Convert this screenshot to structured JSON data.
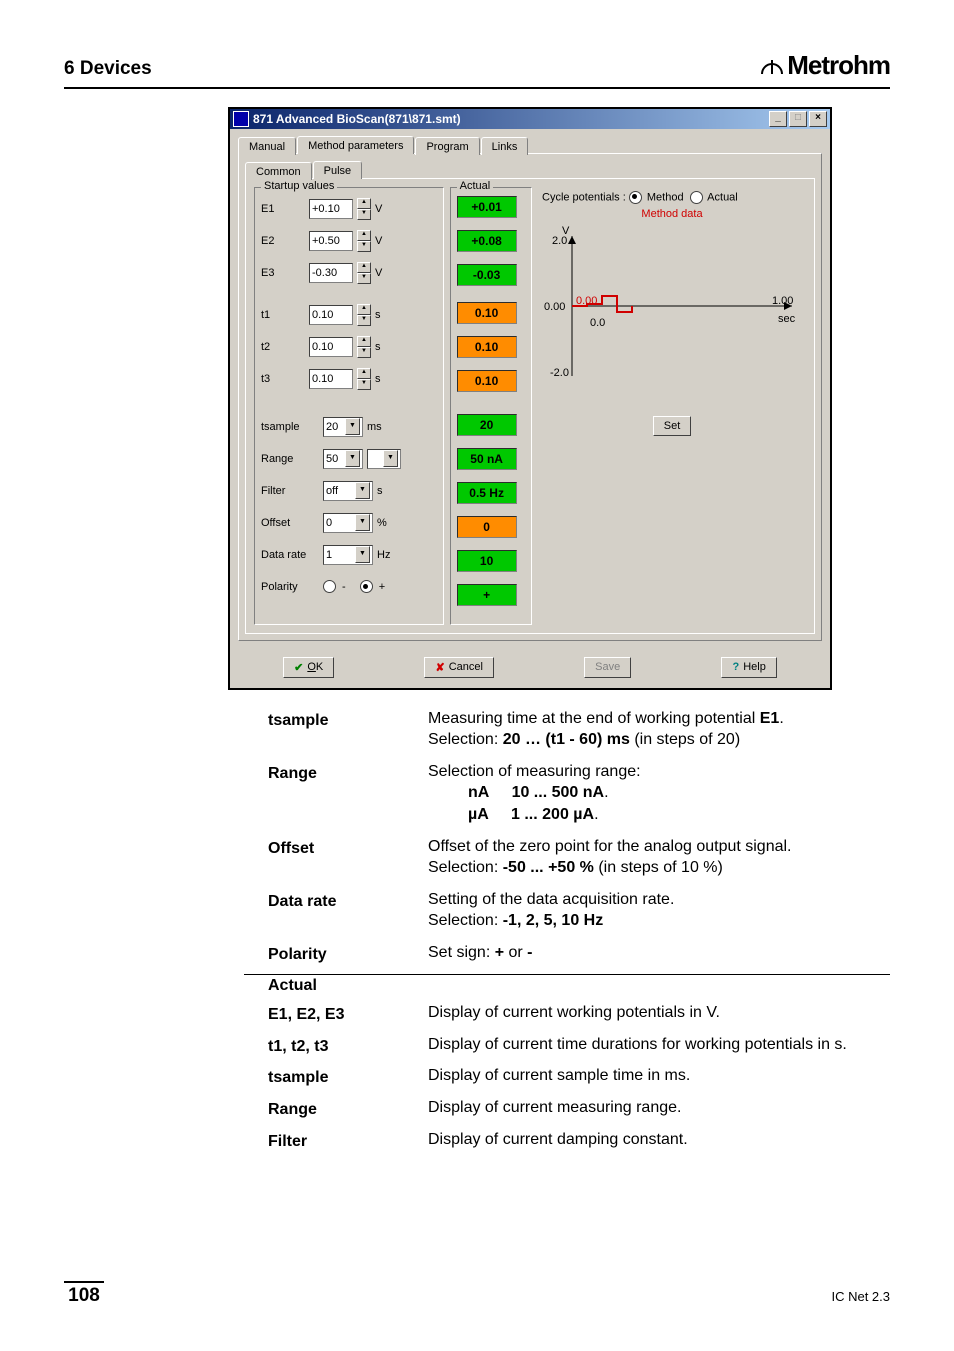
{
  "header": {
    "section": "6 Devices",
    "brand": "Metrohm"
  },
  "window": {
    "title": "871 Advanced BioScan(871\\871.smt)",
    "tabs": {
      "manual": "Manual",
      "method": "Method parameters",
      "program": "Program",
      "links": "Links"
    },
    "subtabs": {
      "common": "Common",
      "pulse": "Pulse"
    }
  },
  "startup": {
    "legend": "Startup values",
    "E1": {
      "label": "E1",
      "value": "+0.10",
      "unit": "V"
    },
    "E2": {
      "label": "E2",
      "value": "+0.50",
      "unit": "V"
    },
    "E3": {
      "label": "E3",
      "value": "-0.30",
      "unit": "V"
    },
    "t1": {
      "label": "t1",
      "value": "0.10",
      "unit": "s"
    },
    "t2": {
      "label": "t2",
      "value": "0.10",
      "unit": "s"
    },
    "t3": {
      "label": "t3",
      "value": "0.10",
      "unit": "s"
    },
    "tsample": {
      "label": "tsample",
      "value": "20",
      "unit": "ms"
    },
    "range": {
      "label": "Range",
      "value": "50",
      "unit2": ""
    },
    "filter": {
      "label": "Filter",
      "value": "off",
      "unit": "s"
    },
    "offset": {
      "label": "Offset",
      "value": "0",
      "unit": "%"
    },
    "datarate": {
      "label": "Data rate",
      "value": "1",
      "unit": "Hz"
    },
    "polarity": {
      "label": "Polarity",
      "minus": "-",
      "plus": "+"
    }
  },
  "actual": {
    "legend": "Actual",
    "E1": "+0.01",
    "E2": "+0.08",
    "E3": "-0.03",
    "t1": "0.10",
    "t2": "0.10",
    "t3": "0.10",
    "tsample": "20",
    "range": "50 nA",
    "filter": "0.5 Hz",
    "offset": "0",
    "datarate": "10",
    "polarity": "+"
  },
  "chart": {
    "cycle_label": "Cycle potentials :",
    "opt_method": "Method",
    "opt_actual": "Actual",
    "caption": "Method data",
    "ylabel": "V",
    "ytop": "2.0",
    "ymid": "0.00",
    "ybot": "-2.0",
    "x0": "0.00",
    "x1": "1.00",
    "xunit": "sec",
    "trace_anchor": "0.0",
    "set_button": "Set"
  },
  "buttons": {
    "ok": "OK",
    "cancel": "Cancel",
    "save": "Save",
    "help": "Help"
  },
  "doc": {
    "tsample": {
      "term": "tsample",
      "line1": "Measuring time at the end of working potential ",
      "e1": "E1",
      "dot1": ".",
      "line2pre": "Selection: ",
      "line2b": "20 … (t1 - 60) ms",
      "line2post": " (in steps of 20)"
    },
    "range": {
      "term": "Range",
      "line1": "Selection of measuring range:",
      "nA_lbl": "nA",
      "nA_val": "10 ... 500 nA",
      "uA_lbl": "µA",
      "uA_val": "1 ... 200 µA",
      "dot": "."
    },
    "offset": {
      "term": "Offset",
      "line1": "Offset of the zero point for the analog output signal.",
      "sel_pre": "Selection: ",
      "sel_b": "-50 ... +50 %",
      "sel_post": " (in steps of 10 %)"
    },
    "datarate": {
      "term": "Data rate",
      "line1": "Setting of the data acquisition rate.",
      "sel_pre": "Selection: ",
      "sel_b": "-1, 2, 5, 10 Hz"
    },
    "polarity": {
      "term": "Polarity",
      "line1": "Set sign: ",
      "plus": "+",
      "or": " or ",
      "minus": "-"
    },
    "actual_hdr": "Actual",
    "aE": {
      "term": "E1, E2, E3",
      "line": "Display of current working potentials in V."
    },
    "at": {
      "term": "t1, t2, t3",
      "line": "Display of current time durations for working potentials in s."
    },
    "atsample": {
      "term": "tsample",
      "line": "Display of current sample time in ms."
    },
    "arange": {
      "term": "Range",
      "line": "Display of current measuring range."
    },
    "afilter": {
      "term": "Filter",
      "line": "Display of current damping constant."
    }
  },
  "footer": {
    "page": "108",
    "product": "IC Net 2.3"
  }
}
